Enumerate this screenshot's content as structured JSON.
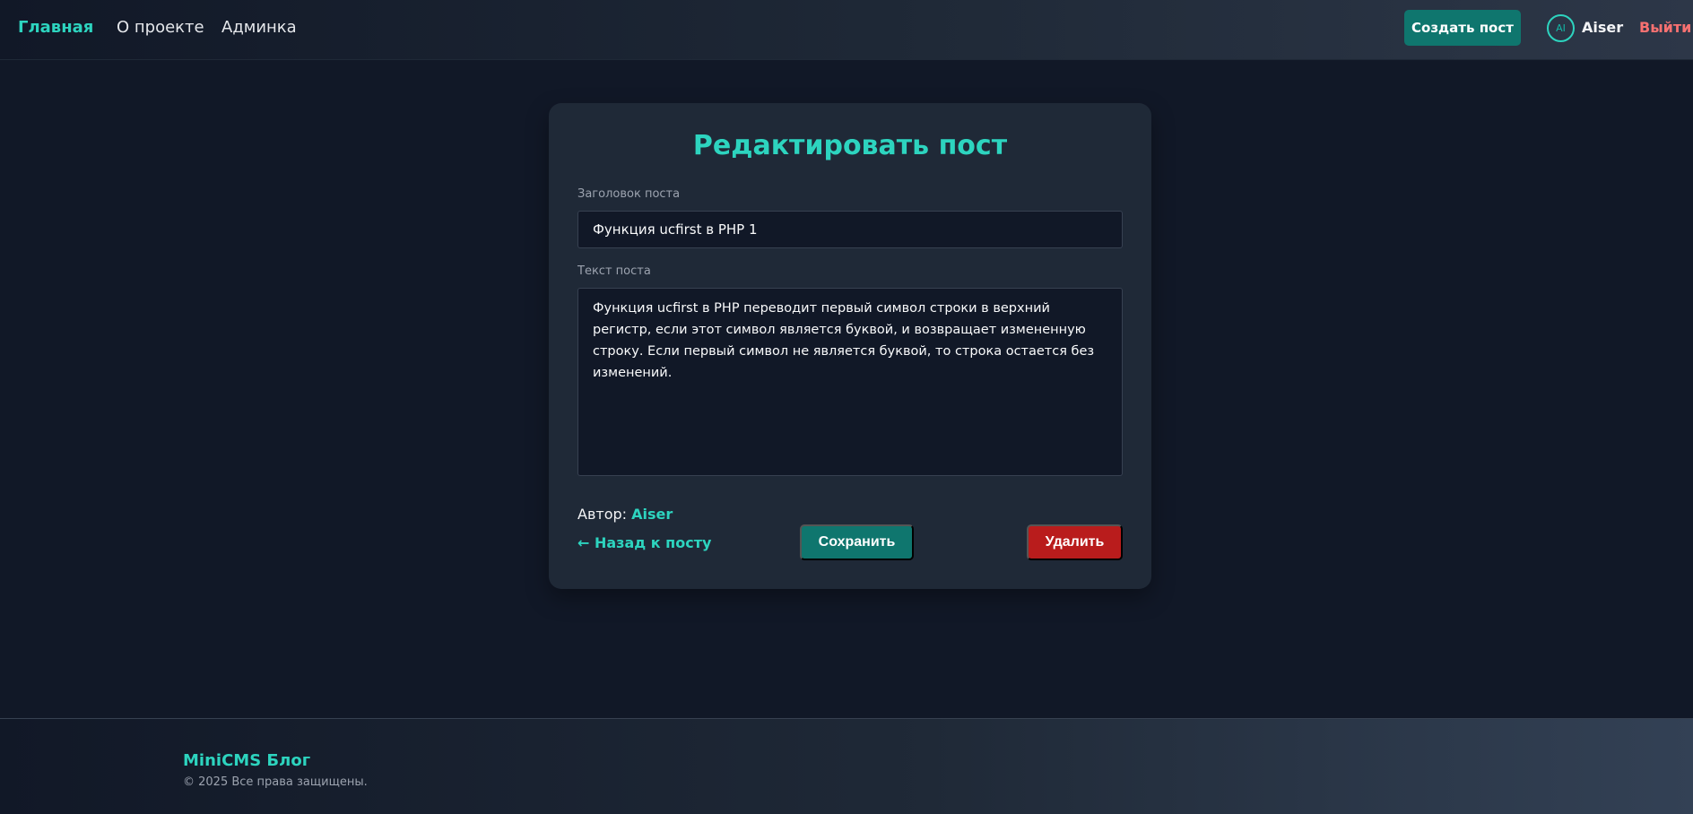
{
  "nav": {
    "home": "Главная",
    "about": "О проекте",
    "admin": "Админка",
    "create_post": "Создать пост",
    "avatar_initials": "AI",
    "username": "Aiser",
    "logout": "Выйти"
  },
  "form": {
    "heading": "Редактировать пост",
    "title_label": "Заголовок поста",
    "title_value": "Функция ucfirst в PHP 1",
    "content_label": "Текст поста",
    "content_value": "Функция ucfirst в PHP переводит первый символ строки в верхний регистр, если этот символ является буквой, и возвращает измененную строку. Если первый символ не является буквой, то строка остается без изменений.",
    "author_label": "Автор:",
    "author_name": "Aiser",
    "back_link": "← Назад к посту",
    "save_button": "Сохранить",
    "delete_button": "Удалить"
  },
  "footer": {
    "brand": "MiniCMS Блог",
    "copyright": "© 2025 Все права защищены."
  },
  "colors": {
    "accent": "#2dd4bf",
    "primary_button": "#0f766e",
    "danger_button": "#b91c1c",
    "logout": "#f87171",
    "background": "#111827",
    "card": "#1f2937"
  }
}
